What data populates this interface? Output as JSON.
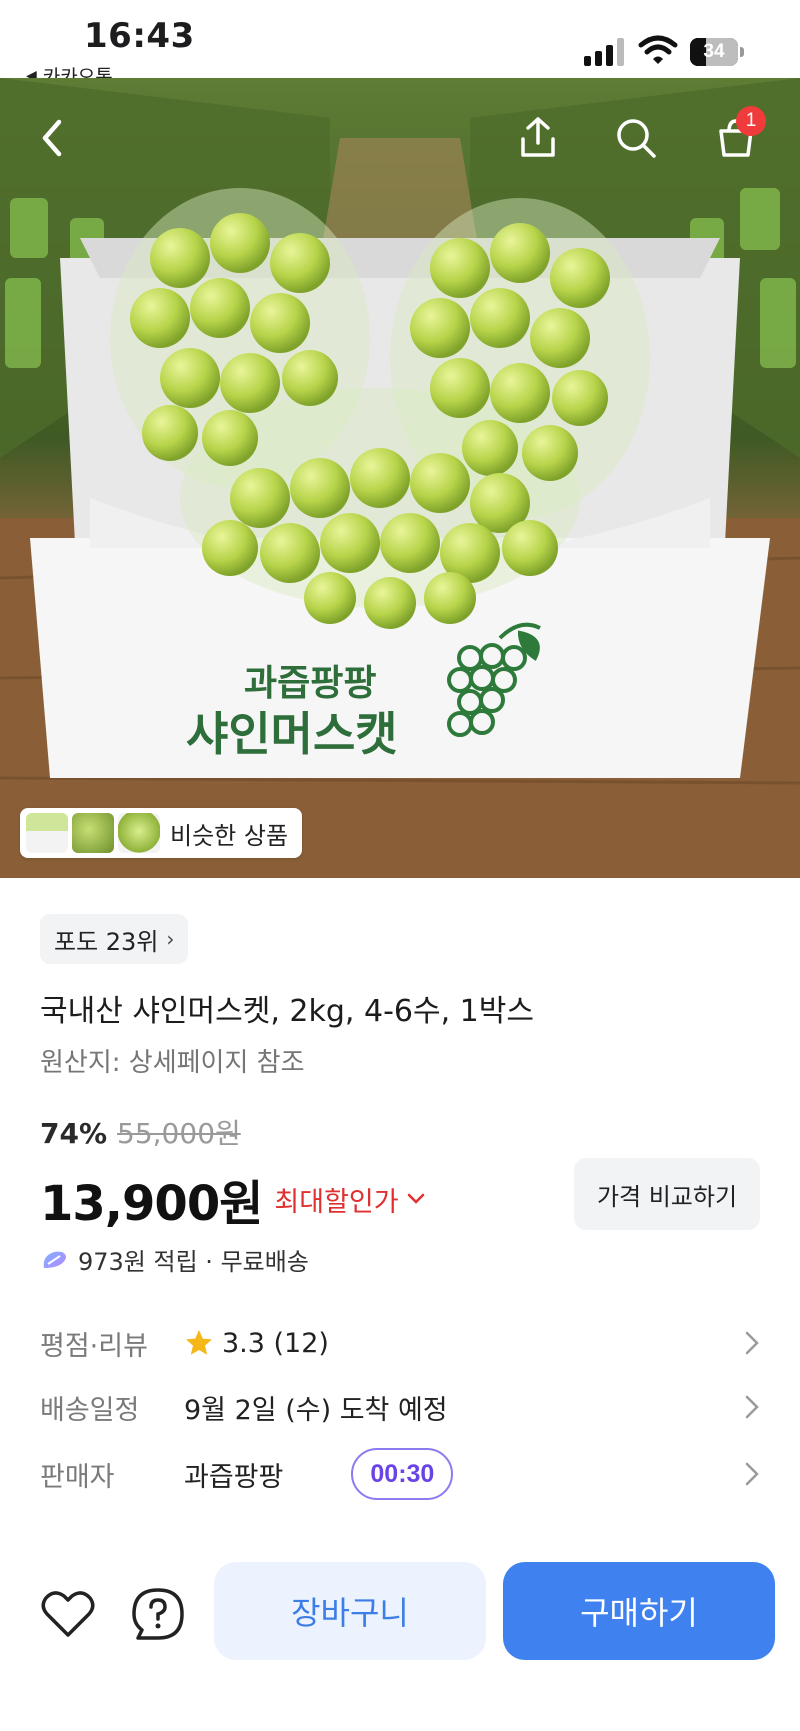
{
  "status_bar": {
    "time": "16:43",
    "back_app_label": "카카오톡",
    "battery_level": "34",
    "battery_percent": 34
  },
  "top_nav": {
    "icons": [
      "back-arrow-icon",
      "share-icon",
      "search-icon",
      "cart-icon"
    ],
    "cart_badge_count": "1"
  },
  "hero": {
    "box_text_line1": "과즙팡팡",
    "box_text_line2": "샤인머스캣",
    "similar_products_label": "비슷한 상품"
  },
  "product": {
    "rank_label": "포도 23위",
    "title": "국내산 샤인머스켓, 2kg, 4-6수, 1박스",
    "origin": "원산지: 상세페이지 참조",
    "discount_rate": "74%",
    "original_price": "55,000원",
    "price": "13,900원",
    "best_price_label": "최대할인가",
    "compare_button": "가격 비교하기",
    "points_shipping": "973원 적립 · 무료배송"
  },
  "info_rows": {
    "rating": {
      "label": "평점·리뷰",
      "value": "3.3 (12)"
    },
    "delivery": {
      "label": "배송일정",
      "value": "9월 2일 (수) 도착 예정"
    },
    "seller": {
      "label": "판매자",
      "value": "과즙팡팡",
      "timer": "00:30"
    }
  },
  "colors": {
    "accent_blue": "#3f81ee",
    "cart_button_bg": "#ecf3ff",
    "discount_red": "#e0302f",
    "timer_purple": "#6a43e6",
    "star_yellow": "#f5b719",
    "badge_red": "#ef3b3b"
  },
  "bottom_bar": {
    "wishlist_icon": "heart-icon",
    "help_icon": "question-icon",
    "cart_button": "장바구니",
    "buy_button": "구매하기"
  }
}
